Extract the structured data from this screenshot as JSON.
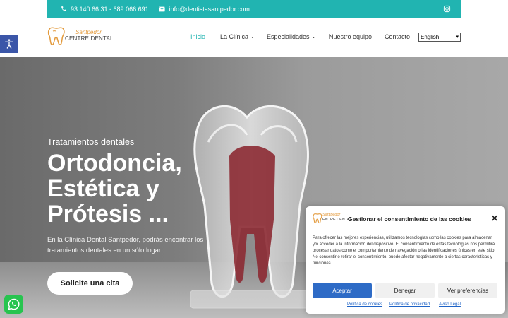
{
  "topbar": {
    "phone": "93 140 66 31 - 689 066 691",
    "email": "info@dentistasantpedor.com",
    "phone_icon": "phone-icon",
    "email_icon": "envelope-icon",
    "social_icon": "instagram-icon"
  },
  "logo": {
    "line1": "Santpedor",
    "line2": "CENTRE DENTAL"
  },
  "nav": {
    "items": [
      {
        "label": "Inicio",
        "active": true
      },
      {
        "label": "La Clínica",
        "dropdown": true
      },
      {
        "label": "Especialidades",
        "dropdown": true
      },
      {
        "label": "Nuestro equipo"
      },
      {
        "label": "Contacto"
      }
    ],
    "language": "English"
  },
  "hero": {
    "subtitle": "Tratamientos dentales",
    "title_lines": [
      "Ortodoncia,",
      "Estética y",
      "Prótesis ..."
    ],
    "description": "En la Clínica Dental Santpedor, podrás encontrar los tratamientos dentales en un sólo lugar:",
    "cta": "Solicite una cita"
  },
  "cookie": {
    "title": "Gestionar el consentimiento de las cookies",
    "text": "Para ofrecer las mejores experiencias, utilizamos tecnologías como las cookies para almacenar y/o acceder a la información del dispositivo. El consentimiento de estas tecnologías nos permitirá procesar datos como el comportamiento de navegación o las identificaciones únicas en este sitio. No consentir o retirar el consentimiento, puede afectar negativamente a ciertas características y funciones.",
    "accept": "Aceptar",
    "deny": "Denegar",
    "preferences": "Ver preferencias",
    "links": [
      "Política de cookies",
      "Política de privacidad",
      "Aviso Legal"
    ]
  },
  "colors": {
    "accent": "#21b4b1",
    "accept_button": "#2e6bc6",
    "accessibility": "#3b56a8",
    "whatsapp": "#27c44f"
  }
}
